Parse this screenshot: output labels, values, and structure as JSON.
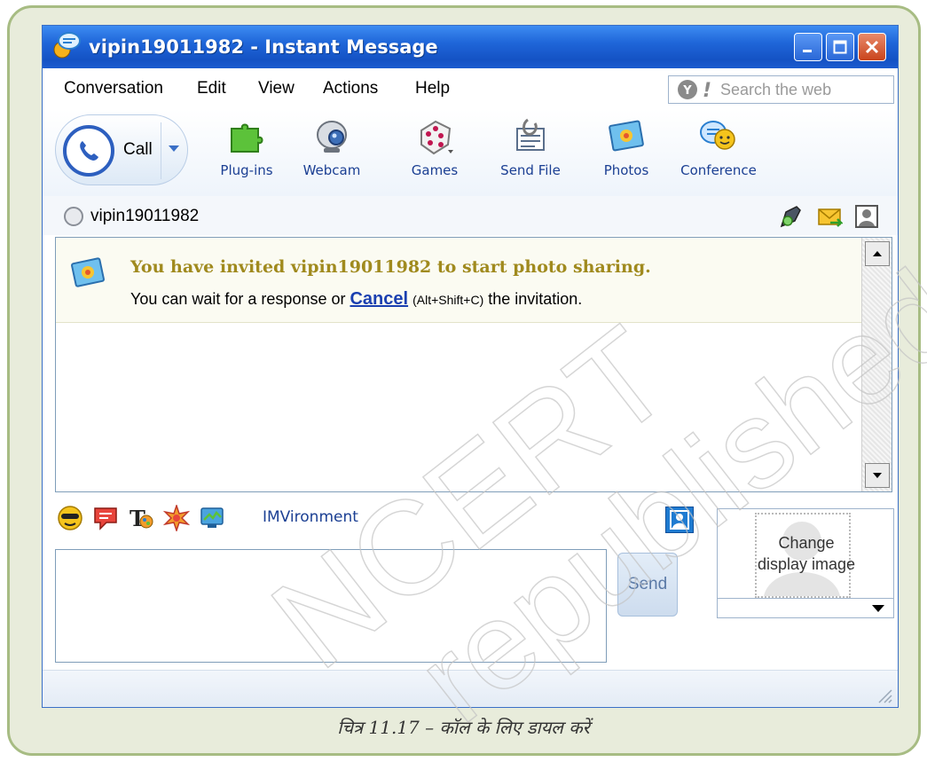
{
  "window": {
    "title": "vipin19011982 - Instant Message"
  },
  "menu": {
    "items": [
      "Conversation",
      "Edit",
      "View",
      "Actions",
      "Help"
    ],
    "search_placeholder": "Search the web"
  },
  "toolbar": {
    "call_label": "Call",
    "tools": [
      "Plug-ins",
      "Webcam",
      "Games",
      "Send File",
      "Photos",
      "Conference"
    ]
  },
  "contact": {
    "name": "vipin19011982"
  },
  "conversation": {
    "invite_title": "You have invited vipin19011982 to start photo sharing.",
    "invite_prefix": "You can wait for a response or ",
    "cancel_link": "Cancel",
    "shortcut": "(Alt+Shift+C)",
    "invite_suffix": " the invitation."
  },
  "emoticons": {
    "imvironment_label": "IMVironment"
  },
  "input": {
    "value": "",
    "send_label": "Send"
  },
  "display_image": {
    "line1": "Change",
    "line2": "display image"
  },
  "caption": "चित्र 11.17 – कॉल के लिए डायल करें",
  "watermark": {
    "line1": "NCERT",
    "line2": "republished"
  },
  "colors": {
    "titlebar": "#1f66d9",
    "frame_border": "#a7bc83",
    "frame_fill": "#e8ecdb",
    "link": "#1a3fb0",
    "invite_title": "#a08a1e"
  }
}
